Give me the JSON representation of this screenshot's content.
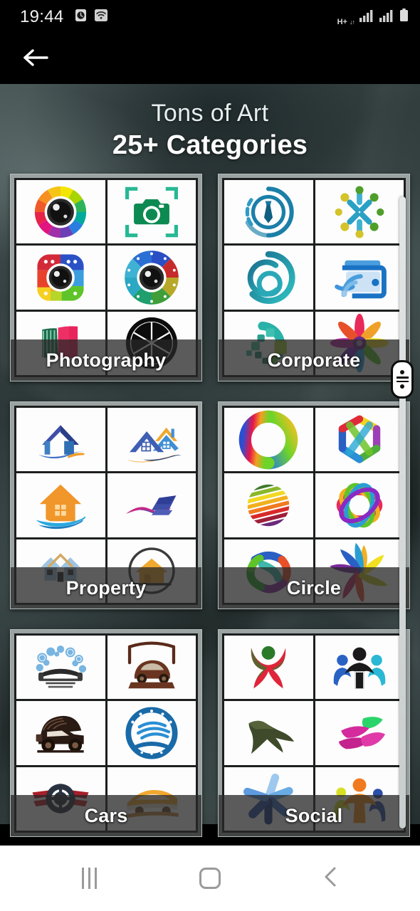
{
  "statusbar": {
    "time": "19:44",
    "icons_left": [
      "alarm-clock-icon",
      "wifi-icon"
    ],
    "network_label": "H+",
    "network_arrows": "↓↑",
    "icons_right": [
      "signal-bars-icon-1",
      "signal-bars-icon-2",
      "battery-icon"
    ]
  },
  "toolbar": {
    "back_icon": "arrow-left-icon"
  },
  "heading": {
    "line1": "Tons of Art",
    "line2": "25+ Categories"
  },
  "scrollbar": {
    "thumb_icon": "drag-handle-icon"
  },
  "categories": [
    {
      "label": "Photography",
      "logos": [
        "color-wheel-camera-lens",
        "green-camera-focus-frame",
        "rainbow-square-camera-app",
        "film-reel-lens-petals",
        "pink-green-brush-stroke",
        "black-aperture-shutter"
      ]
    },
    {
      "label": "Corporate",
      "logos": [
        "necktie-in-circle",
        "teamwork-people-burst",
        "teal-swirl-spiral",
        "blue-wallet-wifi",
        "pixel-squares-arc",
        "rainbow-star-flower"
      ]
    },
    {
      "label": "Property",
      "logos": [
        "blue-house-roof-swoosh",
        "twin-roof-homes-orange-blue",
        "orange-house-blue-swoosh",
        "purple-wave-roof",
        "two-small-houses",
        "house-in-circle-ring"
      ]
    },
    {
      "label": "Circle",
      "logos": [
        "rainbow-gradient-ring",
        "twisted-color-hexagon-ring",
        "striped-rainbow-sphere",
        "woven-color-loops",
        "green-blue-twist-ring",
        "rainbow-pinwheel-fan"
      ]
    },
    {
      "label": "Cars",
      "logos": [
        "car-wash-bubbles",
        "brown-vintage-beetle",
        "black-classic-car",
        "blue-car-wave-circle",
        "red-wings-steering-wheel",
        "orange-sports-car"
      ]
    },
    {
      "label": "Social",
      "logos": [
        "red-green-person-figure",
        "three-people-raised-arms",
        "flying-bird-silhouette",
        "pink-green-leaves-swoosh",
        "blue-pinwheel-people",
        "family-group-figures"
      ]
    }
  ],
  "navbar": {
    "buttons": [
      "recents-button",
      "home-button",
      "back-button"
    ]
  },
  "colors": {
    "card_frame": "#9aa2a2",
    "card_border": "#1d1f1f",
    "label_bar": "rgba(40,40,40,0.76)",
    "background": "#2b3636",
    "navbar": "#ffffff",
    "statusbar": "#000000"
  }
}
